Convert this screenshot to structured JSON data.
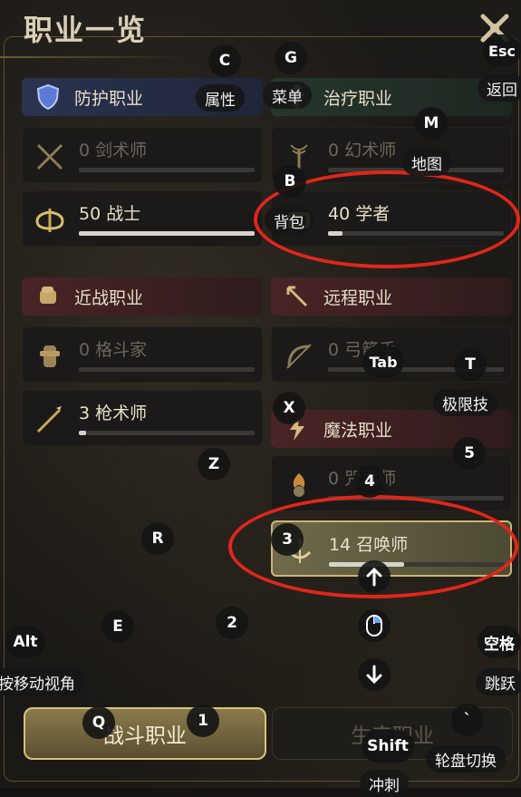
{
  "window": {
    "title": "职业一览"
  },
  "categories": {
    "defense": "防护职业",
    "healer": "治疗职业",
    "melee": "近战职业",
    "ranged": "远程职业",
    "magic": "魔法职业"
  },
  "jobs": {
    "fencer": {
      "text": "0 剑术师",
      "progress": 0
    },
    "conjurer": {
      "text": "0 幻术师",
      "progress": 0
    },
    "warrior": {
      "text": "50 战士",
      "progress": 1.0
    },
    "scholar": {
      "text": "40 学者",
      "progress": 0.08
    },
    "pugilist": {
      "text": "0 格斗家",
      "progress": 0
    },
    "archer": {
      "text": "0 弓箭手",
      "progress": 0
    },
    "lancer": {
      "text": "3 枪术师",
      "progress": 0.04
    },
    "thaumaturge": {
      "text": "0 咒术师",
      "progress": 0
    },
    "summoner": {
      "text": "14 召唤师",
      "progress": 0.43
    }
  },
  "bottom_tabs": {
    "combat": "战斗职业",
    "production": "生产职业"
  },
  "hints": {
    "c": {
      "key": "C",
      "label": "属性"
    },
    "g": {
      "key": "G",
      "label": "菜单"
    },
    "esc": {
      "key": "Esc",
      "label": "返回"
    },
    "m": {
      "key": "M",
      "label": "地图"
    },
    "b": {
      "key": "B",
      "label": "背包"
    },
    "tab": {
      "key": "Tab"
    },
    "t": {
      "key": "T",
      "label": "极限技"
    },
    "x": {
      "key": "X"
    },
    "five": {
      "key": "5"
    },
    "four": {
      "key": "4"
    },
    "z": {
      "key": "Z"
    },
    "r": {
      "key": "R"
    },
    "three": {
      "key": "3"
    },
    "two": {
      "key": "2"
    },
    "e": {
      "key": "E"
    },
    "alt": {
      "key": "Alt",
      "label": "按移动视角"
    },
    "space": {
      "key": "空格",
      "label": "跳跃"
    },
    "q": {
      "key": "Q"
    },
    "one": {
      "key": "1"
    },
    "backtick": {
      "key": "`",
      "label": "轮盘切换"
    },
    "shift": {
      "key": "Shift",
      "label": "冲刺"
    }
  },
  "colors": {
    "highlight_ring": "#e0261b",
    "gold": "#d8c27a"
  }
}
